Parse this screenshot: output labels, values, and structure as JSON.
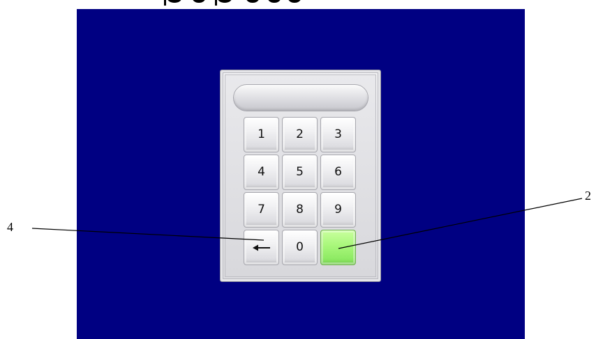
{
  "keypad": {
    "display_value": "",
    "keys": [
      {
        "label": "1"
      },
      {
        "label": "2"
      },
      {
        "label": "3"
      },
      {
        "label": "4"
      },
      {
        "label": "5"
      },
      {
        "label": "6"
      },
      {
        "label": "7"
      },
      {
        "label": "8"
      },
      {
        "label": "9"
      },
      {
        "icon": "backspace-arrow-icon"
      },
      {
        "label": "0"
      },
      {
        "icon": "enter-blank-green",
        "color": "#a8f77a"
      }
    ]
  },
  "callouts": {
    "left": "4",
    "right": "2"
  },
  "colors": {
    "screen_background": "#000082",
    "ok_key": "#a8f77a"
  }
}
